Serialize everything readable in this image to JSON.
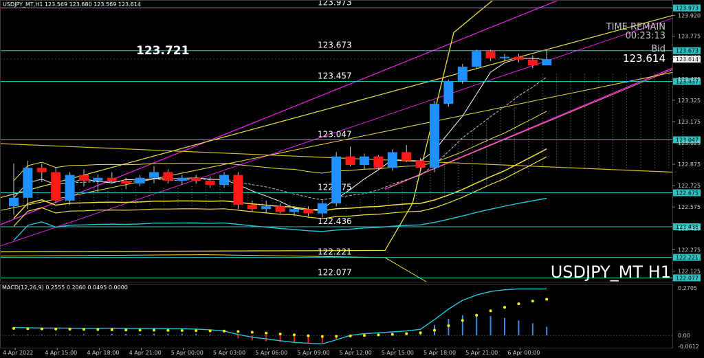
{
  "header": {
    "symbol_line": "USDJPY_MT,H1  123.569 123.680 123.569 123.614",
    "big_price": "123.721",
    "time_remain_label": "TIME REMAIN",
    "time_remain_value": "00:23:13",
    "bid_label": "Bid",
    "bid_value": "123.614",
    "watermark": "USDJPY_MT H1"
  },
  "colors": {
    "bull": "#1e90ff",
    "bear": "#ff1a1a",
    "hline": "#2fc2c2",
    "channel": "#e020e0",
    "yellow": "#f0e040",
    "macd_line": "#20c8d8",
    "signal": "#f5f500",
    "hist": "#3a8be0"
  },
  "chart_data": [
    {
      "type": "candlestick",
      "title": "USDJPY_MT,H1",
      "ylim": [
        122.05,
        124.0
      ],
      "y_ticks": [
        "123.920",
        "123.775",
        "123.625",
        "123.475",
        "123.325",
        "123.175",
        "123.025",
        "122.875",
        "122.725",
        "122.575",
        "122.425",
        "122.275",
        "122.125"
      ],
      "x_ticks": [
        "4 Apr 2022",
        "4 Apr 15:00",
        "4 Apr 18:00",
        "4 Apr 21:00",
        "5 Apr 00:00",
        "5 Apr 03:00",
        "5 Apr 06:00",
        "5 Apr 09:00",
        "5 Apr 12:00",
        "5 Apr 15:00",
        "5 Apr 18:00",
        "5 Apr 21:00",
        "6 Apr 00:00"
      ],
      "levels": [
        {
          "value": 123.973,
          "label": "123.973",
          "tag": "123.973"
        },
        {
          "value": 123.673,
          "label": "123.673",
          "tag": "123.673"
        },
        {
          "value": 123.457,
          "label": "123.457",
          "tag": "123.457"
        },
        {
          "value": 123.047,
          "label": "123.047",
          "tag": "123.047"
        },
        {
          "value": 122.675,
          "label": "122.675",
          "tag": "122.675"
        },
        {
          "value": 122.436,
          "label": "122.436",
          "tag": "122.436"
        },
        {
          "value": 122.221,
          "label": "122.221",
          "tag": "122.221"
        },
        {
          "value": 122.077,
          "label": "122.077",
          "tag": "122.077"
        }
      ],
      "current_price": {
        "value": 123.614,
        "tag": "123.614"
      },
      "candles": [
        {
          "o": 122.58,
          "h": 122.88,
          "l": 122.52,
          "c": 122.64
        },
        {
          "o": 122.64,
          "h": 122.9,
          "l": 122.56,
          "c": 122.85
        },
        {
          "o": 122.85,
          "h": 122.88,
          "l": 122.75,
          "c": 122.82
        },
        {
          "o": 122.82,
          "h": 122.85,
          "l": 122.6,
          "c": 122.62
        },
        {
          "o": 122.62,
          "h": 122.82,
          "l": 122.59,
          "c": 122.8
        },
        {
          "o": 122.8,
          "h": 122.84,
          "l": 122.72,
          "c": 122.76
        },
        {
          "o": 122.76,
          "h": 122.8,
          "l": 122.68,
          "c": 122.78
        },
        {
          "o": 122.78,
          "h": 122.82,
          "l": 122.74,
          "c": 122.76
        },
        {
          "o": 122.76,
          "h": 122.78,
          "l": 122.7,
          "c": 122.74
        },
        {
          "o": 122.74,
          "h": 122.8,
          "l": 122.72,
          "c": 122.78
        },
        {
          "o": 122.78,
          "h": 122.86,
          "l": 122.74,
          "c": 122.82
        },
        {
          "o": 122.82,
          "h": 122.84,
          "l": 122.74,
          "c": 122.76
        },
        {
          "o": 122.76,
          "h": 122.8,
          "l": 122.73,
          "c": 122.78
        },
        {
          "o": 122.78,
          "h": 122.8,
          "l": 122.74,
          "c": 122.76
        },
        {
          "o": 122.76,
          "h": 122.79,
          "l": 122.71,
          "c": 122.73
        },
        {
          "o": 122.73,
          "h": 122.82,
          "l": 122.71,
          "c": 122.8
        },
        {
          "o": 122.8,
          "h": 122.82,
          "l": 122.56,
          "c": 122.59
        },
        {
          "o": 122.59,
          "h": 122.62,
          "l": 122.54,
          "c": 122.56
        },
        {
          "o": 122.56,
          "h": 122.62,
          "l": 122.53,
          "c": 122.58
        },
        {
          "o": 122.58,
          "h": 122.6,
          "l": 122.53,
          "c": 122.54
        },
        {
          "o": 122.54,
          "h": 122.58,
          "l": 122.51,
          "c": 122.56
        },
        {
          "o": 122.56,
          "h": 122.58,
          "l": 122.51,
          "c": 122.53
        },
        {
          "o": 122.53,
          "h": 122.62,
          "l": 122.5,
          "c": 122.6
        },
        {
          "o": 122.6,
          "h": 122.96,
          "l": 122.58,
          "c": 122.93
        },
        {
          "o": 122.93,
          "h": 123.0,
          "l": 122.86,
          "c": 122.87
        },
        {
          "o": 122.87,
          "h": 122.95,
          "l": 122.84,
          "c": 122.93
        },
        {
          "o": 122.93,
          "h": 122.94,
          "l": 122.84,
          "c": 122.85
        },
        {
          "o": 122.85,
          "h": 122.98,
          "l": 122.83,
          "c": 122.96
        },
        {
          "o": 122.96,
          "h": 123.01,
          "l": 122.89,
          "c": 122.9
        },
        {
          "o": 122.9,
          "h": 122.92,
          "l": 122.83,
          "c": 122.85
        },
        {
          "o": 122.85,
          "h": 123.32,
          "l": 122.82,
          "c": 123.3
        },
        {
          "o": 123.3,
          "h": 123.47,
          "l": 123.28,
          "c": 123.46
        },
        {
          "o": 123.46,
          "h": 123.58,
          "l": 123.44,
          "c": 123.56
        },
        {
          "o": 123.56,
          "h": 123.68,
          "l": 123.55,
          "c": 123.67
        },
        {
          "o": 123.67,
          "h": 123.68,
          "l": 123.6,
          "c": 123.62
        },
        {
          "o": 123.62,
          "h": 123.65,
          "l": 123.6,
          "c": 123.63
        },
        {
          "o": 123.63,
          "h": 123.65,
          "l": 123.59,
          "c": 123.61
        },
        {
          "o": 123.61,
          "h": 123.64,
          "l": 123.55,
          "c": 123.57
        },
        {
          "o": 123.57,
          "h": 123.68,
          "l": 123.57,
          "c": 123.614
        }
      ]
    },
    {
      "type": "macd",
      "title": "MACD(12,26,9) 0.2555 0.2060 0.0495 0.0000",
      "ylim": [
        -0.07,
        0.29
      ],
      "y_ticks": [
        "0.2705",
        "0.00",
        "-0.0612"
      ],
      "macd_line": [
        0.045,
        0.043,
        0.042,
        0.042,
        0.041,
        0.04,
        0.04,
        0.041,
        0.04,
        0.039,
        0.039,
        0.038,
        0.038,
        0.036,
        0.032,
        0.025,
        0.005,
        -0.01,
        -0.02,
        -0.03,
        -0.04,
        -0.045,
        -0.048,
        -0.025,
        0.0,
        0.01,
        0.015,
        0.02,
        0.025,
        0.035,
        0.09,
        0.15,
        0.2,
        0.23,
        0.25,
        0.26,
        0.265,
        0.265,
        0.265
      ],
      "signal_line": [
        0.04,
        0.038,
        0.037,
        0.036,
        0.035,
        0.034,
        0.033,
        0.032,
        0.031,
        0.03,
        0.03,
        0.029,
        0.028,
        0.027,
        0.026,
        0.025,
        0.022,
        0.018,
        0.013,
        0.008,
        0.003,
        -0.002,
        -0.006,
        -0.005,
        -0.003,
        0.0,
        0.003,
        0.006,
        0.01,
        0.015,
        0.03,
        0.055,
        0.085,
        0.115,
        0.14,
        0.16,
        0.18,
        0.195,
        0.206
      ],
      "histogram": [
        0.005,
        0.005,
        0.005,
        0.006,
        0.006,
        0.006,
        0.007,
        0.009,
        0.009,
        0.009,
        0.009,
        0.009,
        0.01,
        0.009,
        0.006,
        0.0,
        -0.017,
        -0.028,
        -0.033,
        -0.038,
        -0.043,
        -0.043,
        -0.042,
        -0.02,
        0.003,
        0.01,
        0.012,
        0.014,
        0.015,
        0.02,
        0.06,
        0.095,
        0.115,
        0.115,
        0.11,
        0.1,
        0.085,
        0.07,
        0.0495
      ]
    }
  ]
}
